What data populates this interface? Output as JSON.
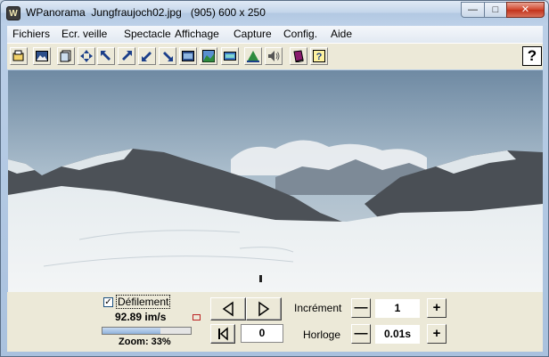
{
  "window": {
    "app_name": "WPanorama",
    "file_name": "Jungfraujoch02.jpg",
    "dimensions": "(905) 600 x 250",
    "icon_letter": "W"
  },
  "titlebar_buttons": {
    "minimize": "—",
    "maximize": "□",
    "close": "✕"
  },
  "menu": [
    "Fichiers",
    "Ecr. veille",
    "Spectacle",
    "Affichage",
    "Capture",
    "Config.",
    "Aide"
  ],
  "toolbar": {
    "icons": [
      "open-file-icon",
      "picture-icon",
      "copy-icon",
      "move-icon",
      "arrow-up-left-icon",
      "arrow-up-right-icon",
      "arrow-down-left-icon",
      "arrow-down-right-icon",
      "film-icon",
      "landscape-icon",
      "window-icon",
      "panorama-icon",
      "sound-icon",
      "book-icon",
      "help-topic-icon"
    ],
    "help": "?"
  },
  "controls": {
    "scroll_label": "Défilement",
    "scroll_checked": true,
    "speed": "92.89 im/s",
    "zoom": "Zoom: 33%",
    "zoom_fraction": 0.66,
    "counter": "0",
    "increment_label": "Incrément",
    "increment_value": "1",
    "clock_label": "Horloge",
    "clock_value": "0.01s",
    "minus": "—",
    "plus": "+"
  }
}
